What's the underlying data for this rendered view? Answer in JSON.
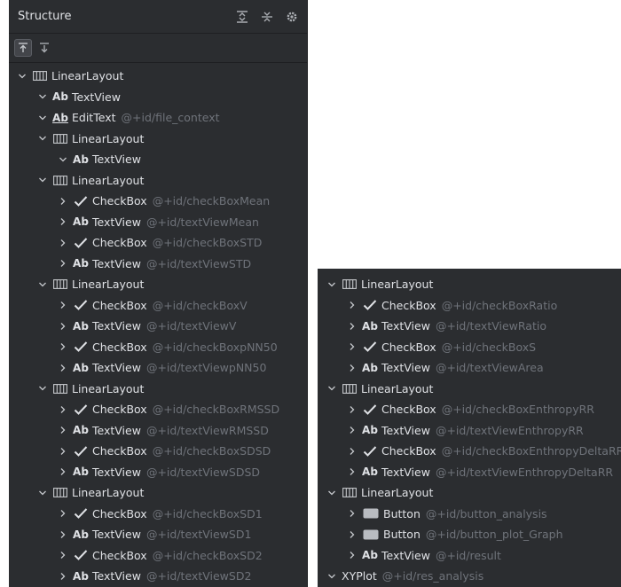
{
  "panel": {
    "title": "Structure",
    "title_icons": [
      "expand-all-icon",
      "collapse-all-icon",
      "gear-icon"
    ],
    "toolbar_icons": [
      "sort-up-icon",
      "sort-down-icon"
    ]
  },
  "left_rows": [
    {
      "d": 0,
      "chev": "down",
      "icon": "ll",
      "label": "LinearLayout",
      "sub": ""
    },
    {
      "d": 1,
      "chev": "down",
      "icon": "ab",
      "label": "TextView",
      "sub": ""
    },
    {
      "d": 1,
      "chev": "down",
      "icon": "abu",
      "label": "EditText",
      "sub": "@+id/file_context"
    },
    {
      "d": 1,
      "chev": "down",
      "icon": "ll",
      "label": "LinearLayout",
      "sub": ""
    },
    {
      "d": 2,
      "chev": "down",
      "icon": "ab",
      "label": "TextView",
      "sub": ""
    },
    {
      "d": 1,
      "chev": "down",
      "icon": "ll",
      "label": "LinearLayout",
      "sub": ""
    },
    {
      "d": 2,
      "chev": "right",
      "icon": "check",
      "label": "CheckBox",
      "sub": "@+id/checkBoxMean"
    },
    {
      "d": 2,
      "chev": "right",
      "icon": "ab",
      "label": "TextView",
      "sub": "@+id/textViewMean"
    },
    {
      "d": 2,
      "chev": "right",
      "icon": "check",
      "label": "CheckBox",
      "sub": "@+id/checkBoxSTD"
    },
    {
      "d": 2,
      "chev": "right",
      "icon": "ab",
      "label": "TextView",
      "sub": "@+id/textViewSTD"
    },
    {
      "d": 1,
      "chev": "down",
      "icon": "ll",
      "label": "LinearLayout",
      "sub": ""
    },
    {
      "d": 2,
      "chev": "right",
      "icon": "check",
      "label": "CheckBox",
      "sub": "@+id/checkBoxV"
    },
    {
      "d": 2,
      "chev": "right",
      "icon": "ab",
      "label": "TextView",
      "sub": "@+id/textViewV"
    },
    {
      "d": 2,
      "chev": "right",
      "icon": "check",
      "label": "CheckBox",
      "sub": "@+id/checkBoxpNN50"
    },
    {
      "d": 2,
      "chev": "right",
      "icon": "ab",
      "label": "TextView",
      "sub": "@+id/textViewpNN50"
    },
    {
      "d": 1,
      "chev": "down",
      "icon": "ll",
      "label": "LinearLayout",
      "sub": ""
    },
    {
      "d": 2,
      "chev": "right",
      "icon": "check",
      "label": "CheckBox",
      "sub": "@+id/checkBoxRMSSD"
    },
    {
      "d": 2,
      "chev": "right",
      "icon": "ab",
      "label": "TextView",
      "sub": "@+id/textViewRMSSD"
    },
    {
      "d": 2,
      "chev": "right",
      "icon": "check",
      "label": "CheckBox",
      "sub": "@+id/checkBoxSDSD"
    },
    {
      "d": 2,
      "chev": "right",
      "icon": "ab",
      "label": "TextView",
      "sub": "@+id/textViewSDSD"
    },
    {
      "d": 1,
      "chev": "down",
      "icon": "ll",
      "label": "LinearLayout",
      "sub": ""
    },
    {
      "d": 2,
      "chev": "right",
      "icon": "check",
      "label": "CheckBox",
      "sub": "@+id/checkBoxSD1"
    },
    {
      "d": 2,
      "chev": "right",
      "icon": "ab",
      "label": "TextView",
      "sub": "@+id/textViewSD1"
    },
    {
      "d": 2,
      "chev": "right",
      "icon": "check",
      "label": "CheckBox",
      "sub": "@+id/checkBoxSD2"
    },
    {
      "d": 2,
      "chev": "right",
      "icon": "ab",
      "label": "TextView",
      "sub": "@+id/textViewSD2"
    }
  ],
  "right_rows": [
    {
      "d": 1,
      "chev": "down",
      "icon": "ll",
      "label": "LinearLayout",
      "sub": ""
    },
    {
      "d": 2,
      "chev": "right",
      "icon": "check",
      "label": "CheckBox",
      "sub": "@+id/checkBoxRatio"
    },
    {
      "d": 2,
      "chev": "right",
      "icon": "ab",
      "label": "TextView",
      "sub": "@+id/textViewRatio"
    },
    {
      "d": 2,
      "chev": "right",
      "icon": "check",
      "label": "CheckBox",
      "sub": "@+id/checkBoxS"
    },
    {
      "d": 2,
      "chev": "right",
      "icon": "ab",
      "label": "TextView",
      "sub": "@+id/textViewArea"
    },
    {
      "d": 1,
      "chev": "down",
      "icon": "ll",
      "label": "LinearLayout",
      "sub": ""
    },
    {
      "d": 2,
      "chev": "right",
      "icon": "check",
      "label": "CheckBox",
      "sub": "@+id/checkBoxEnthropyRR"
    },
    {
      "d": 2,
      "chev": "right",
      "icon": "ab",
      "label": "TextView",
      "sub": "@+id/textViewEnthropyRR"
    },
    {
      "d": 2,
      "chev": "right",
      "icon": "check",
      "label": "CheckBox",
      "sub": "@+id/checkBoxEnthropyDeltaRR"
    },
    {
      "d": 2,
      "chev": "right",
      "icon": "ab",
      "label": "TextView",
      "sub": "@+id/textViewEnthropyDeltaRR"
    },
    {
      "d": 1,
      "chev": "down",
      "icon": "ll",
      "label": "LinearLayout",
      "sub": ""
    },
    {
      "d": 2,
      "chev": "right",
      "icon": "button",
      "label": "Button",
      "sub": "@+id/button_analysis"
    },
    {
      "d": 2,
      "chev": "right",
      "icon": "button",
      "label": "Button",
      "sub": "@+id/button_plot_Graph"
    },
    {
      "d": 2,
      "chev": "right",
      "icon": "ab",
      "label": "TextView",
      "sub": "@+id/result"
    },
    {
      "d": 1,
      "chev": "down",
      "icon": "none",
      "label": "XYPlot",
      "sub": "@+id/res_analysis"
    }
  ]
}
